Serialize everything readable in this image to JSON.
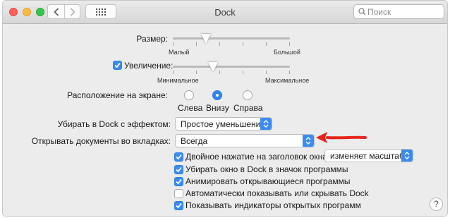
{
  "window": {
    "title": "Dock"
  },
  "search": {
    "placeholder": "Поиск"
  },
  "size": {
    "label": "Размер:",
    "min_label": "Малый",
    "max_label": "Большой",
    "level": 0.29
  },
  "magnification": {
    "label": "Увеличение:",
    "checked": true,
    "min_label": "Минимальное",
    "max_label": "Максимальное",
    "level": 0.35
  },
  "position": {
    "label": "Расположение на экране:",
    "options": [
      {
        "label": "Слева",
        "selected": false
      },
      {
        "label": "Внизу",
        "selected": true
      },
      {
        "label": "Справа",
        "selected": false
      }
    ]
  },
  "minimize_effect": {
    "label": "Убирать в Dock с эффектом:",
    "value": "Простое уменьшение"
  },
  "tabs": {
    "label": "Открывать документы во вкладках:",
    "value": "Всегда"
  },
  "options": [
    {
      "label": "Двойное нажатие на заголовок окна:",
      "checked": true
    },
    {
      "label": "Убирать окно в Dock в значок программы",
      "checked": true
    },
    {
      "label": "Анимировать открывающиеся программы",
      "checked": true
    },
    {
      "label": "Автоматически показывать или скрывать Dock",
      "checked": false
    },
    {
      "label": "Показывать индикаторы открытых программ",
      "checked": true
    }
  ],
  "double_click_action": {
    "value": "изменяет масштаб"
  },
  "help": {
    "label": "?"
  },
  "colors": {
    "accent": "#3a8cf3",
    "annotation_arrow": "#e8241e"
  }
}
